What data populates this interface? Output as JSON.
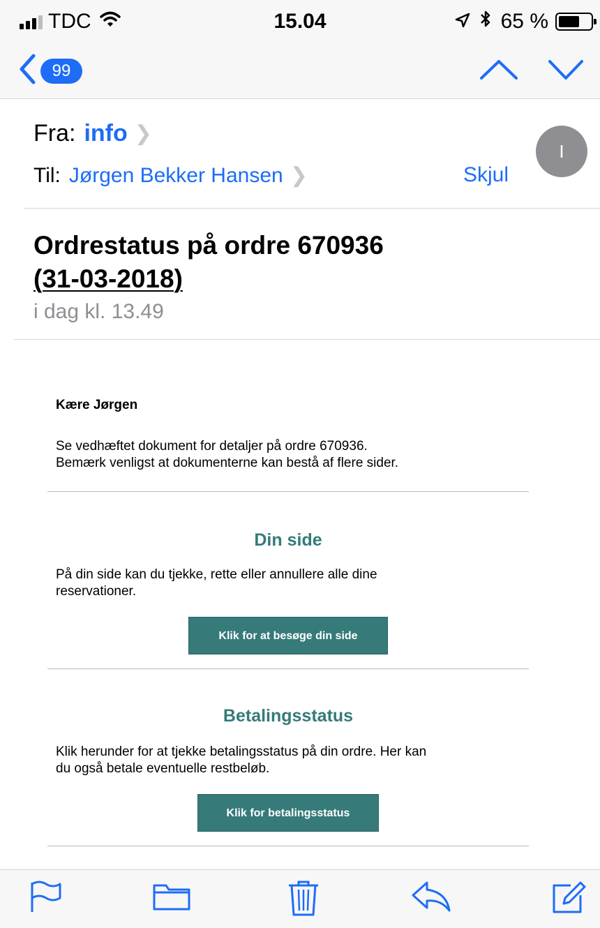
{
  "status_bar": {
    "carrier": "TDC",
    "time": "15.04",
    "battery_text": "65 %",
    "battery_level": 0.65
  },
  "nav": {
    "unread_count": "99",
    "icons": {
      "back": "chevron-left-icon",
      "up": "chevron-up-icon",
      "down": "chevron-down-icon"
    }
  },
  "header": {
    "from_label": "Fra:",
    "from_name": "info",
    "to_label": "Til:",
    "to_name": "Jørgen Bekker Hansen",
    "hide_label": "Skjul",
    "avatar_initial": "I"
  },
  "message": {
    "subject_line1": "Ordrestatus på ordre 670936",
    "subject_line2": "(31-03-2018)",
    "date": "i dag kl. 13.49"
  },
  "body": {
    "greeting": "Kære Jørgen",
    "intro_line1": "Se vedhæftet dokument for detaljer på ordre 670936.",
    "intro_line2": "Bemærk venligst at dokumenterne kan bestå af flere sider.",
    "section1": {
      "title": "Din side",
      "text_line1": "På din side kan du tjekke, rette eller annullere alle dine",
      "text_line2": "reservationer.",
      "button": "Klik for at besøge din side"
    },
    "section2": {
      "title": "Betalingsstatus",
      "text_line1": "Klik herunder for at tjekke betalingsstatus på din ordre. Her kan",
      "text_line2": "du også betale eventuelle restbeløb.",
      "button": "Klik for betalingsstatus"
    },
    "accent_color": "#367a7a"
  },
  "toolbar": {
    "icons": [
      "flag-icon",
      "folder-icon",
      "trash-icon",
      "reply-icon",
      "compose-icon"
    ]
  },
  "colors": {
    "ios_blue": "#1d6df6",
    "bar_background": "#f7f7f7"
  }
}
